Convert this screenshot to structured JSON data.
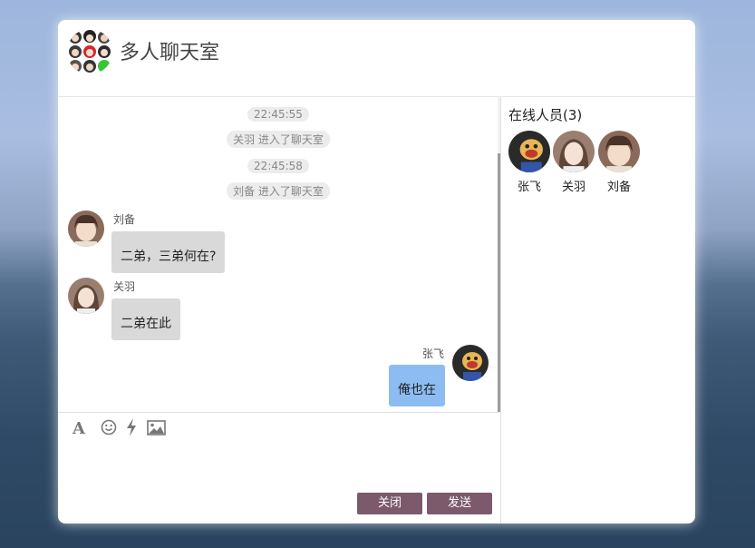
{
  "window": {
    "title": "多人聊天室"
  },
  "messages": [
    {
      "type": "system",
      "time": "22:45:55",
      "text": "关羽 进入了聊天室"
    },
    {
      "type": "system",
      "time": "22:45:58",
      "text": "刘备 进入了聊天室"
    },
    {
      "type": "incoming",
      "sender": "刘备",
      "text": "二弟，三弟何在?"
    },
    {
      "type": "incoming",
      "sender": "关羽",
      "text": "二弟在此"
    },
    {
      "type": "outgoing",
      "sender": "张飞",
      "text": "俺也在"
    }
  ],
  "toolbar": {
    "icons": [
      "font-icon",
      "emoji-icon",
      "lightning-icon",
      "image-icon"
    ],
    "input_value": ""
  },
  "buttons": {
    "close_label": "关闭",
    "send_label": "发送"
  },
  "online": {
    "title": "在线人员(3)",
    "members": [
      {
        "name": "张飞"
      },
      {
        "name": "关羽"
      },
      {
        "name": "刘备"
      }
    ]
  },
  "colors": {
    "button_bg": "#7c5a6b",
    "bubble_incoming": "#d9d9d9",
    "bubble_outgoing": "#8cbcf2",
    "system_pill": "#ececec"
  }
}
